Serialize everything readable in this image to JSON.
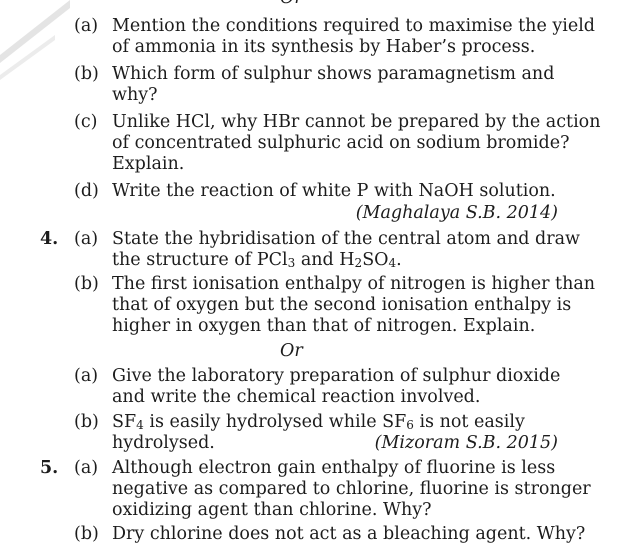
{
  "or_label": "Or",
  "q3": {
    "a": {
      "label": "(a)",
      "lines": [
        "Mention the conditions required to maximise the yield",
        "of ammonia in its synthesis by Haber’s process."
      ]
    },
    "b": {
      "label": "(b)",
      "lines": [
        "Which form of sulphur shows paramagnetism and",
        "why?"
      ]
    },
    "c": {
      "label": "(c)",
      "lines": [
        "Unlike HCl, why HBr cannot be prepared by the action",
        "of concentrated sulphuric acid on sodium bromide?",
        "Explain."
      ]
    },
    "d": {
      "label": "(d)",
      "lines": [
        "Write the reaction of white P with NaOH solution."
      ]
    },
    "source": "(Maghalaya S.B. 2014)"
  },
  "q4": {
    "number": "4.",
    "a": {
      "label": "(a)",
      "line1": "State the hybridisation of the central atom and draw",
      "line2_pre": "the structure of PCl",
      "sub1": "3",
      "line2_mid": " and H",
      "sub2": "2",
      "line2_mid2": "SO",
      "sub3": "4",
      "line2_end": "."
    },
    "b": {
      "label": "(b)",
      "lines": [
        "The first ionisation enthalpy of nitrogen is higher than",
        "that of oxygen but the second ionisation enthalpy is",
        "higher in oxygen than that of nitrogen. Explain."
      ]
    },
    "or_a": {
      "label": "(a)",
      "lines": [
        "Give the laboratory preparation of sulphur dioxide",
        "and write the chemical reaction involved."
      ]
    },
    "or_b": {
      "label": "(b)",
      "pre": "SF",
      "sub1": "4",
      "mid": " is easily hydrolysed while SF",
      "sub2": "6",
      "end": " is not easily",
      "line2": "hydrolysed."
    },
    "source": "(Mizoram S.B. 2015)"
  },
  "q5": {
    "number": "5.",
    "a": {
      "label": "(a)",
      "lines": [
        "Although electron gain enthalpy of fluorine is less",
        "negative as compared to chlorine, fluorine is stronger",
        "oxidizing agent than chlorine. Why?"
      ]
    },
    "b": {
      "label": "(b)",
      "lines": [
        "Dry chlorine does not act as a bleaching agent. Why?"
      ]
    }
  },
  "colors": {
    "text": "#1c1c1c",
    "decoration": "#d9d9d9"
  }
}
